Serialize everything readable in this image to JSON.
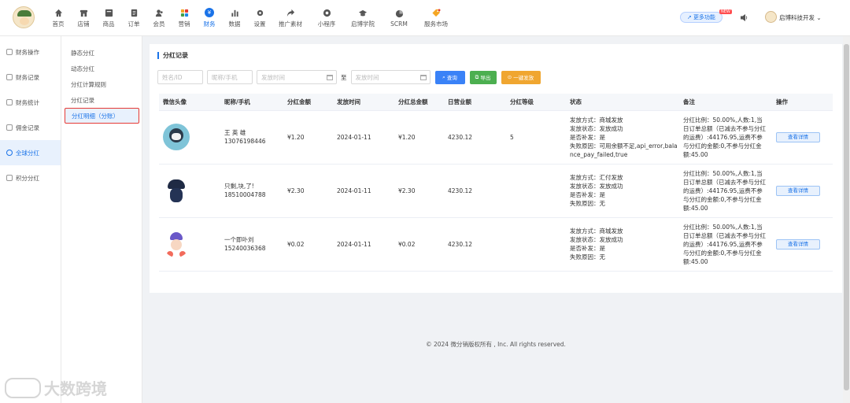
{
  "nav": {
    "items": [
      {
        "label": "首页",
        "icon": "home-icon"
      },
      {
        "label": "店铺",
        "icon": "store-icon"
      },
      {
        "label": "商品",
        "icon": "goods-icon"
      },
      {
        "label": "订单",
        "icon": "order-icon"
      },
      {
        "label": "会员",
        "icon": "member-icon"
      },
      {
        "label": "营销",
        "icon": "marketing-icon"
      },
      {
        "label": "财务",
        "icon": "finance-icon"
      },
      {
        "label": "数据",
        "icon": "data-icon"
      },
      {
        "label": "设置",
        "icon": "settings-icon"
      },
      {
        "label": "推广素材",
        "icon": "share-icon"
      },
      {
        "label": "小程序",
        "icon": "miniapp-icon"
      },
      {
        "label": "启博学院",
        "icon": "academy-icon"
      },
      {
        "label": "SCRM",
        "icon": "scrm-icon"
      },
      {
        "label": "服务市场",
        "icon": "market-icon"
      }
    ],
    "finance_glyph": "¥",
    "more_label": "更多功能",
    "new_badge": "NEW",
    "user_name": "启博科技开发"
  },
  "sidebar1": {
    "items": [
      "财务操作",
      "财务记录",
      "财务统计",
      "佣金记录",
      "全球分红",
      "积分分红"
    ]
  },
  "sidebar2": {
    "items": [
      "静态分红",
      "动态分红",
      "分红计算规则",
      "分红记录",
      "分红明细（分账）"
    ]
  },
  "section_title": "分红记录",
  "filters": {
    "name_placeholder": "姓名/ID",
    "nick_placeholder": "昵称/手机",
    "start_placeholder": "发放时间",
    "to_label": "至",
    "end_placeholder": "发放时间",
    "search_label": "查询",
    "export_label": "导出",
    "send_label": "一键发放"
  },
  "table": {
    "headers": [
      "微信头像",
      "昵称/手机",
      "分红金额",
      "发放时间",
      "分红总金额",
      "日营业额",
      "分红等级",
      "状态",
      "备注",
      "操作"
    ],
    "rows": [
      {
        "nickname": "王 英 雄",
        "phone": "13076198446",
        "amount": "¥1.20",
        "time": "2024-01-11",
        "total": "¥1.20",
        "daily": "4230.12",
        "level": "5",
        "status": [
          "发放方式：商城发放",
          "发放状态：发放成功",
          "是否补发：是",
          "失败原因：可用余额不足,api_error,balance_pay_failed,true"
        ],
        "note": "分红比例：50.00%,人数:1,当日订单总额（已减去不参与分红的运费）:44176.95,运费不参与分红的金额:0,不参与分红金额:45.00",
        "action": "查看详情"
      },
      {
        "nickname": "只剩,块,了!",
        "phone": "18510004788",
        "amount": "¥2.30",
        "time": "2024-01-11",
        "total": "¥2.30",
        "daily": "4230.12",
        "level": "",
        "status": [
          "发放方式：汇付发放",
          "发放状态：发放成功",
          "是否补发：是",
          "失败原因：无"
        ],
        "note": "分红比例：50.00%,人数:1,当日订单总额（已减去不参与分红的运费）:44176.95,运费不参与分红的金额:0,不参与分红金额:45.00",
        "action": "查看详情"
      },
      {
        "nickname": "一个即卟刘",
        "phone": "15240036368",
        "amount": "¥0.02",
        "time": "2024-01-11",
        "total": "¥0.02",
        "daily": "4230.12",
        "level": "",
        "status": [
          "发放方式：商城发放",
          "发放状态：发放成功",
          "是否补发：是",
          "失败原因：无"
        ],
        "note": "分红比例：50.00%,人数:1,当日订单总额（已减去不参与分红的运费）:44176.95,运费不参与分红的金额:0,不参与分红金额:45.00",
        "action": "查看详情"
      }
    ]
  },
  "footer": "© 2024 微分销版权所有 , Inc. All rights reserved.",
  "watermark": "大数跨境"
}
